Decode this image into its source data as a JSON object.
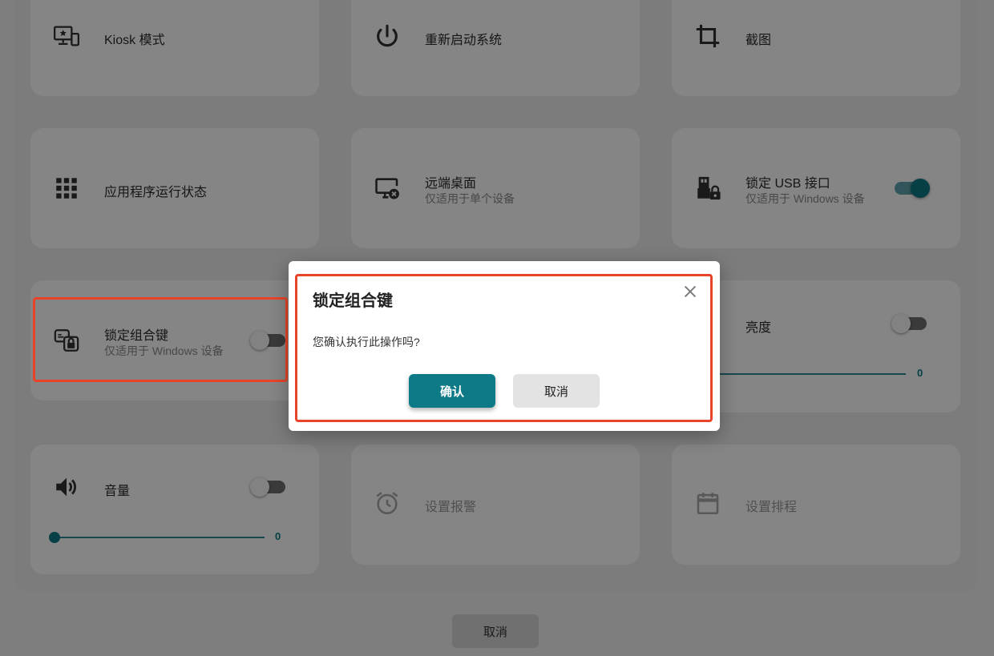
{
  "cards": {
    "kiosk": {
      "title": "Kiosk 模式",
      "icon": "kiosk-icon"
    },
    "restart": {
      "title": "重新启动系统",
      "icon": "power-icon"
    },
    "screenshot": {
      "title": "截图",
      "icon": "crop-icon"
    },
    "app_status": {
      "title": "应用程序运行状态",
      "icon": "apps-grid-icon"
    },
    "remote_desktop": {
      "title": "远端桌面",
      "subtitle": "仅适用于单个设备",
      "icon": "remote-desktop-icon"
    },
    "lock_usb": {
      "title": "锁定 USB 接口",
      "subtitle": "仅适用于 Windows 设备",
      "icon": "usb-lock-icon",
      "toggle_on": true
    },
    "lock_keys": {
      "title": "锁定组合键",
      "subtitle": "仅适用于 Windows 设备",
      "icon": "key-combo-lock-icon",
      "toggle_on": false
    },
    "brightness": {
      "title": "亮度",
      "value": "0",
      "toggle_on": false
    },
    "volume": {
      "title": "音量",
      "value": "0",
      "icon": "speaker-icon",
      "toggle_on": false
    },
    "alarm": {
      "title": "设置报警",
      "icon": "alarm-icon"
    },
    "schedule": {
      "title": "设置排程",
      "icon": "calendar-icon"
    }
  },
  "footer": {
    "cancel_label": "取消"
  },
  "dialog": {
    "title": "锁定组合键",
    "message": "您确认执行此操作吗?",
    "confirm_label": "确认",
    "cancel_label": "取消"
  },
  "colors": {
    "accent": "#0e7a88",
    "highlight": "#e8442a"
  }
}
